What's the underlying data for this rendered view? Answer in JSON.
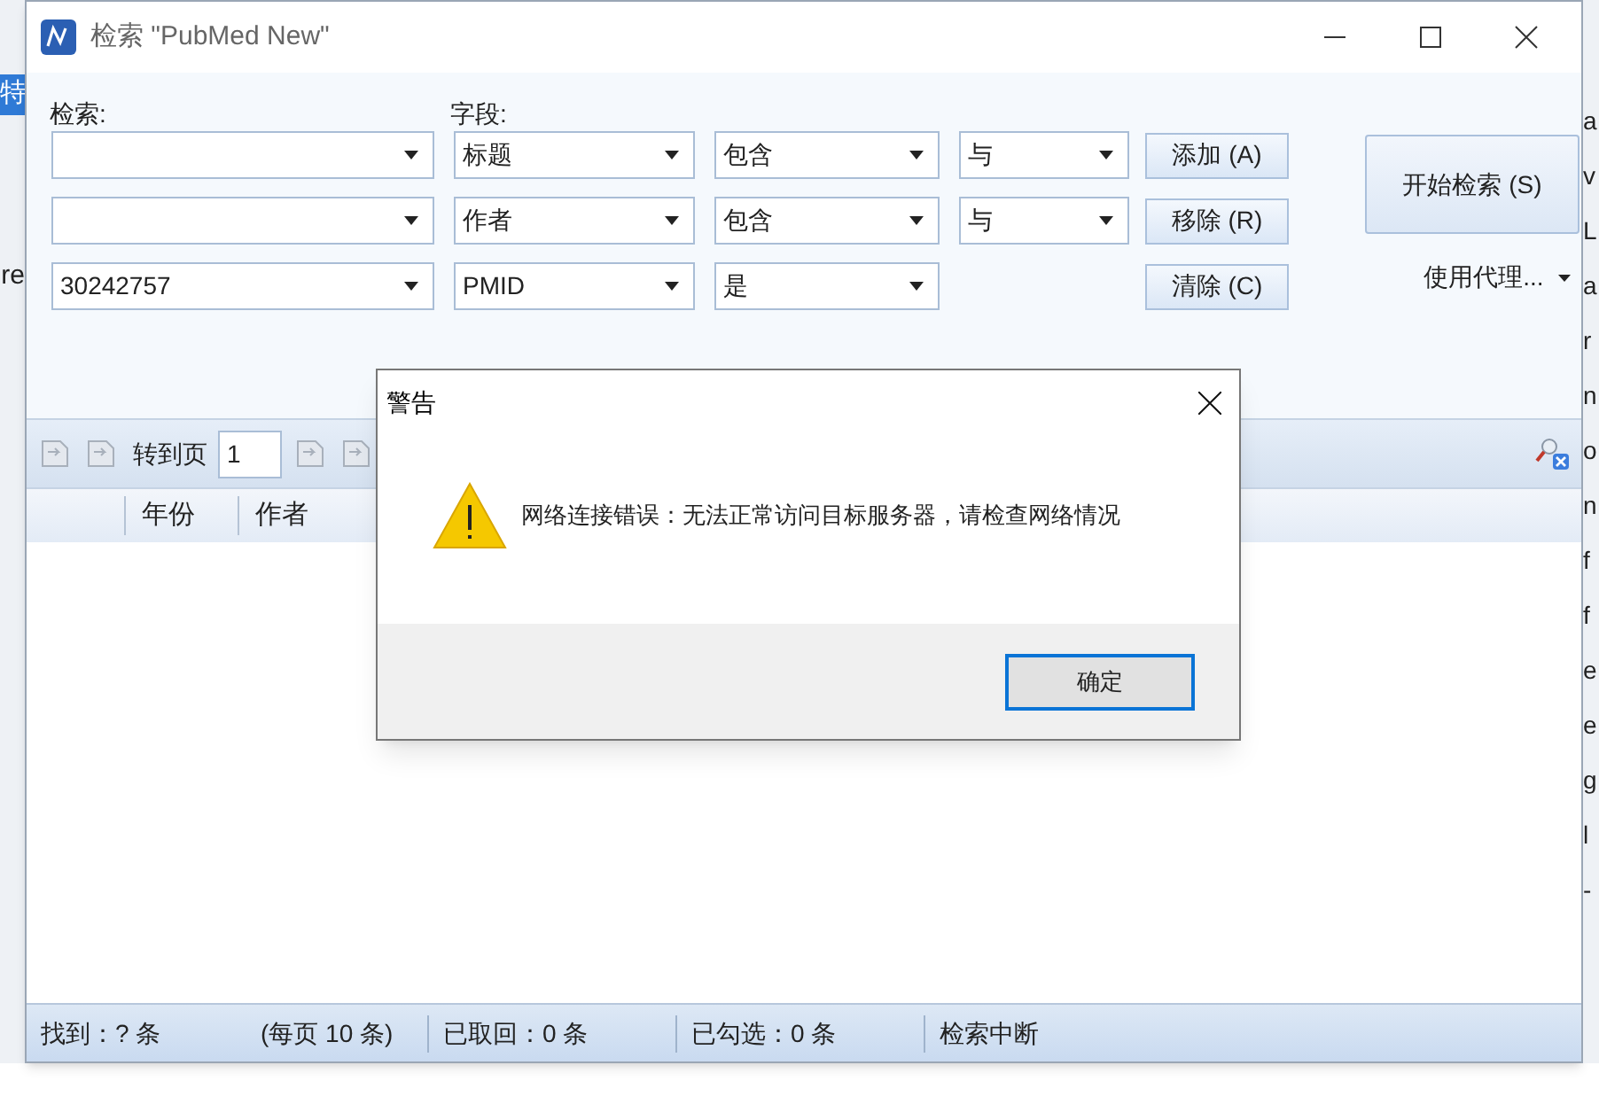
{
  "background_app": {
    "left_fragments": [
      "特",
      "re"
    ],
    "right_fragments": [
      "a",
      "v",
      "L",
      "a",
      "r",
      "n",
      "o",
      "n",
      "f",
      "f",
      "e",
      "e",
      "g",
      "l",
      "-"
    ]
  },
  "window": {
    "title": "检索 \"PubMed New\""
  },
  "form": {
    "search_label": "检索:",
    "field_label": "字段:",
    "rows": [
      {
        "term": "",
        "field": "标题",
        "operator": "包含",
        "boolean": "与"
      },
      {
        "term": "",
        "field": "作者",
        "operator": "包含",
        "boolean": "与"
      },
      {
        "term": "30242757",
        "field": "PMID",
        "operator": "是"
      }
    ],
    "buttons": [
      "添加 (A)",
      "移除 (R)",
      "清除 (C)"
    ],
    "start_button": "开始检索 (S)",
    "proxy": "使用代理..."
  },
  "toolbar": {
    "goto_label": "转到页",
    "page": "1"
  },
  "table": {
    "columns": [
      "年份",
      "作者"
    ]
  },
  "status_bar": [
    "找到：? 条",
    "(每页 10 条)",
    "已取回：0 条",
    "已勾选：0 条",
    "检索中断"
  ],
  "dialog": {
    "title": "警告",
    "message": "网络连接错误：无法正常访问目标服务器，请检查网络情况",
    "ok_button": "确定"
  }
}
